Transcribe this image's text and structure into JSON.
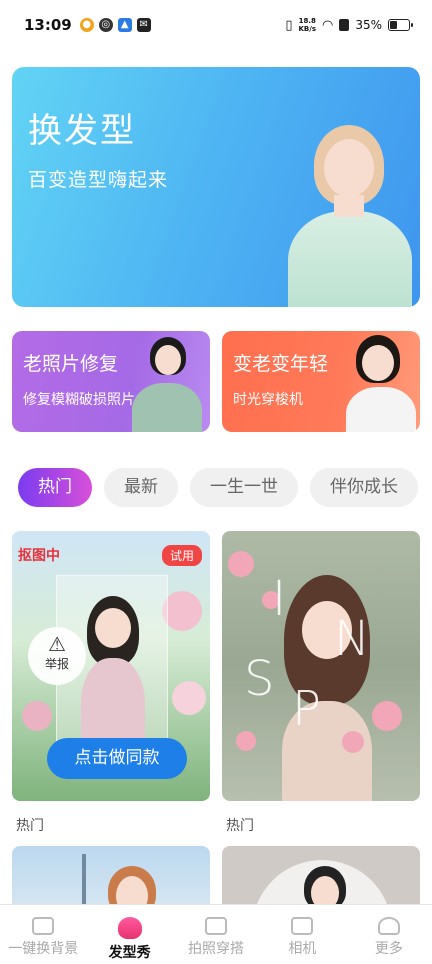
{
  "status_bar": {
    "time": "13:09",
    "net_speed_value": "18.8",
    "net_speed_unit": "KB/s",
    "battery": "35%"
  },
  "hero": {
    "title": "换发型",
    "subtitle": "百变造型嗨起来"
  },
  "features": [
    {
      "title": "老照片修复",
      "subtitle": "修复模糊破损照片"
    },
    {
      "title": "变老变年轻",
      "subtitle": "时光穿梭机"
    }
  ],
  "tabs": [
    "热门",
    "最新",
    "一生一世",
    "伴你成长"
  ],
  "grid": [
    {
      "status_badge": "抠图中",
      "trial_badge": "试用",
      "report_label": "举报",
      "cta_label": "点击做同款",
      "caption": "热门"
    },
    {
      "caption": "热门"
    }
  ],
  "nav": {
    "items": [
      "一键换背景",
      "发型秀",
      "拍照穿搭",
      "相机",
      "更多"
    ],
    "active_index": 1
  },
  "colors": {
    "accent_purple": "#7a3cf0",
    "accent_pink": "#d84fd8",
    "cta_blue": "#1e7fe8",
    "alert_red": "#e8323c"
  }
}
